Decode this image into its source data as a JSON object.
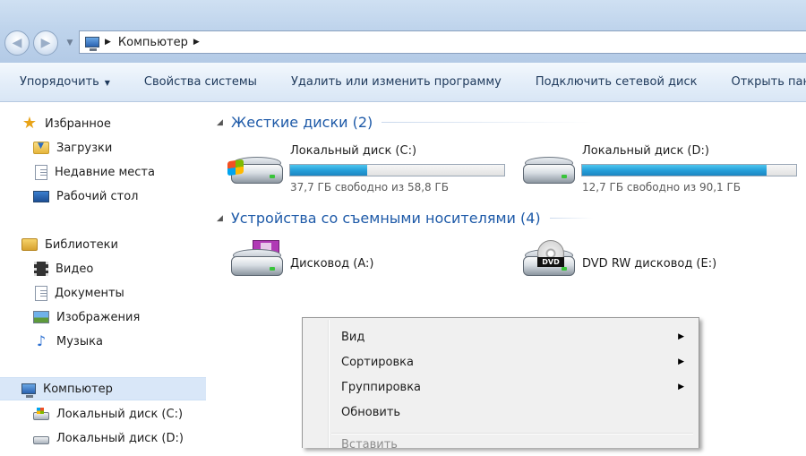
{
  "address": {
    "crumbs": [
      "Компьютер"
    ]
  },
  "toolbar": {
    "organize": "Упорядочить",
    "system_properties": "Свойства системы",
    "uninstall": "Удалить или изменить программу",
    "map_drive": "Подключить сетевой диск",
    "open_panel": "Открыть панель управления"
  },
  "nav": {
    "favorites": "Избранное",
    "downloads": "Загрузки",
    "recent": "Недавние места",
    "desktop": "Рабочий стол",
    "libraries": "Библиотеки",
    "video": "Видео",
    "documents": "Документы",
    "pictures": "Изображения",
    "music": "Музыка",
    "computer": "Компьютер",
    "disk_c": "Локальный диск (C:)",
    "disk_d": "Локальный диск (D:)"
  },
  "content": {
    "hdd_group": "Жесткие диски (2)",
    "removable_group": "Устройства со съемными носителями (4)",
    "drive_c": {
      "name": "Локальный диск (C:)",
      "free_text": "37,7 ГБ свободно из 58,8 ГБ",
      "used_fraction": 0.36
    },
    "drive_d": {
      "name": "Локальный диск (D:)",
      "free_text": "12,7 ГБ свободно из 90,1 ГБ",
      "used_fraction": 0.86
    },
    "floppy": "Дисковод (A:)",
    "dvd": "DVD RW дисковод (E:)",
    "dvd_badge": "DVD"
  },
  "context_menu": {
    "view": "Вид",
    "sort": "Сортировка",
    "group": "Группировка",
    "refresh": "Обновить",
    "paste": "Вставить"
  },
  "colors": {
    "accent": "#1e5aa8",
    "progress": "#26a0da",
    "selection": "#d9e7f8"
  }
}
